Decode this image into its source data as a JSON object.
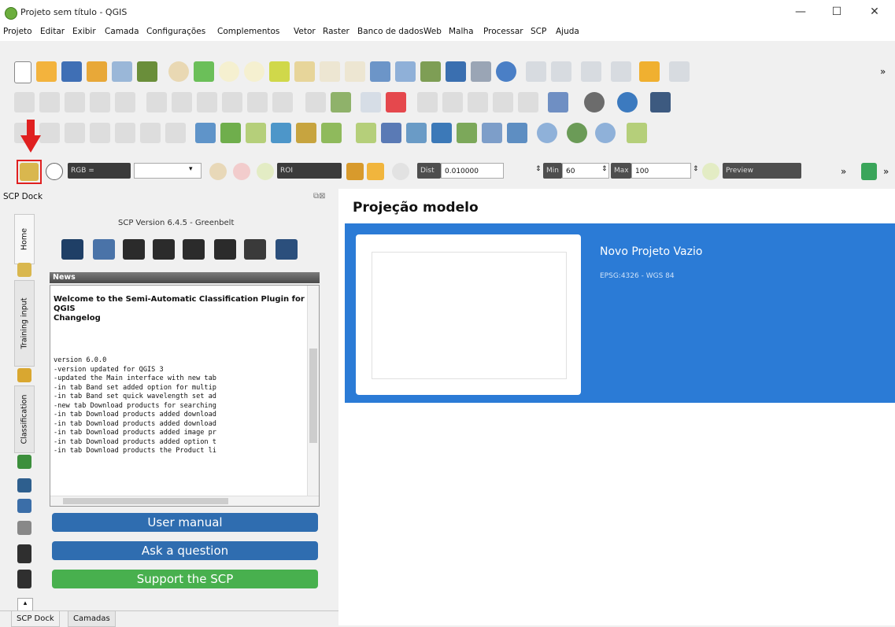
{
  "window": {
    "title": "Projeto sem título - QGIS",
    "min_glyph": "—",
    "max_glyph": "☐",
    "close_glyph": "✕"
  },
  "menu": [
    "Projeto",
    "Editar",
    "Exibir",
    "Camada",
    "Configurações",
    "Complementos",
    "Vetor",
    "Raster",
    "Banco de dados",
    "Web",
    "Malha",
    "Processar",
    "SCP",
    "Ajuda"
  ],
  "toolbar": {
    "overflow": "»"
  },
  "scp_toolbar": {
    "rgb_label": "RGB =",
    "roi_label": "ROI",
    "dist_label": "Dist",
    "dist_value": "0.010000",
    "min_label": "Min",
    "min_value": "60",
    "max_label": "Max",
    "max_value": "100",
    "preview_label": "Preview",
    "overflow": "»"
  },
  "dock": {
    "title": "SCP Dock",
    "version": "SCP Version 6.4.5 - Greenbelt",
    "tabs": [
      "Home",
      "Training input",
      "Classification"
    ],
    "news_header": "News",
    "welcome": "Welcome to the Semi-Automatic Classification Plugin for QGIS\nChangelog",
    "changelog": "version 6.0.0\n-version updated for QGIS 3\n-updated the Main interface with new tab\n-in tab Band set added option for multip\n-in tab Band set quick wavelength set ad\n-new tab Download products for searching\n-in tab Download products added download\n-in tab Download products added download\n-in tab Download products added image pr\n-in tab Download products added option t\n-in tab Download products the Product li",
    "buttons": {
      "manual": "User manual",
      "question": "Ask a question",
      "support": "Support the SCP"
    },
    "bottom_tabs": [
      "SCP Dock",
      "Camadas"
    ]
  },
  "main": {
    "section_title": "Projeção modelo",
    "project_name": "Novo Projeto Vazio",
    "crs": "EPSG:4326 - WGS 84"
  },
  "colors": {
    "accent_blue": "#2b7bd6",
    "button_blue": "#2f6db0",
    "button_green": "#48b04e",
    "highlight_red": "#e02020"
  }
}
